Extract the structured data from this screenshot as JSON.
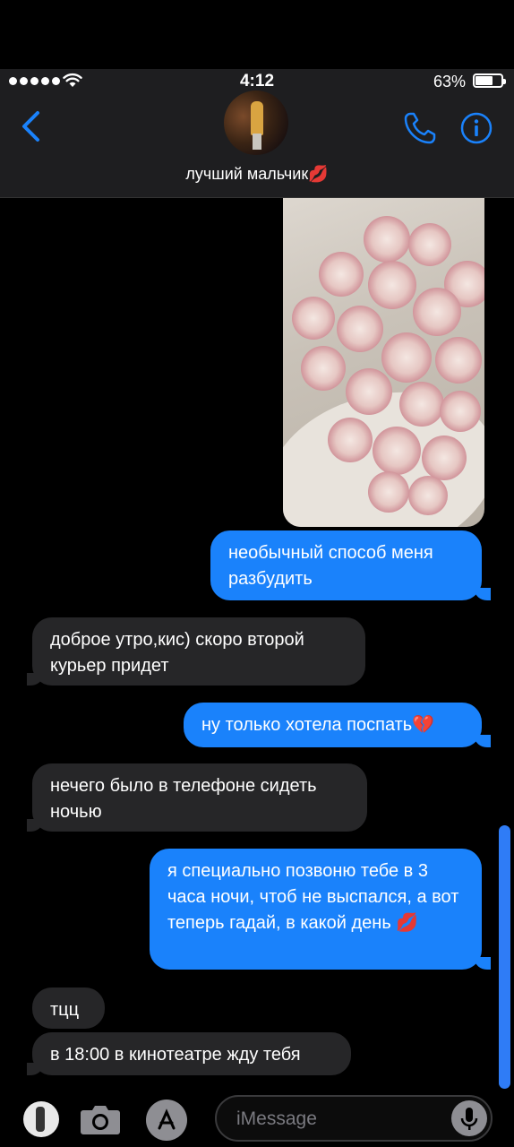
{
  "status_bar": {
    "time": "4:12",
    "battery": "63%",
    "battery_level": 0.63
  },
  "header": {
    "contact_name": "лучший мальчик💋"
  },
  "messages": [
    {
      "dir": "out",
      "text": "необычный способ меня разбудить"
    },
    {
      "dir": "in",
      "text": "доброе утро,кис) скоро второй курьер придет"
    },
    {
      "dir": "out",
      "text": "ну только хотела поспать💔"
    },
    {
      "dir": "in",
      "text": "нечего было в телефоне сидеть ночью"
    },
    {
      "dir": "out",
      "text": "я специально позвоню тебе в 3 часа ночи, чтоб не выспался, а вот теперь гадай, в какой день 💋"
    },
    {
      "dir": "in",
      "text": "тцц"
    },
    {
      "dir": "in",
      "text": "в 18:00 в кинотеатре жду тебя"
    }
  ],
  "photo": {
    "sticker": "♥"
  },
  "input_bar": {
    "placeholder": "iMessage"
  },
  "icons": {
    "back": "chevron-left-icon",
    "call": "phone-icon",
    "info": "info-icon",
    "camera": "camera-icon",
    "apps": "app-store-icon",
    "mic": "microphone-icon"
  },
  "colors": {
    "accent": "#1a82fb",
    "incoming": "#262628",
    "header": "#1e1e20"
  }
}
